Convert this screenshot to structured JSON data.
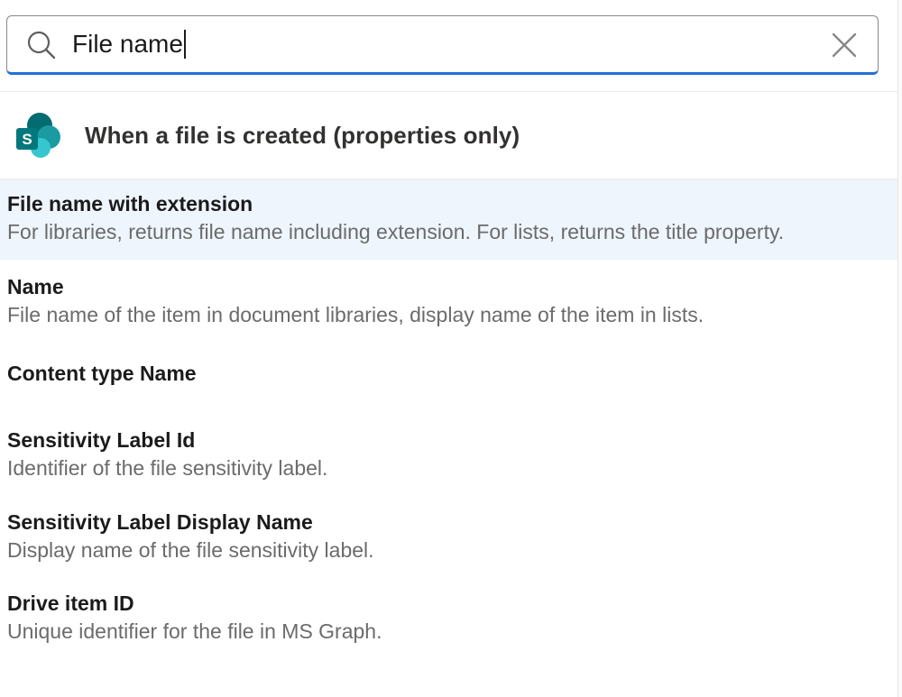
{
  "search": {
    "value": "File name",
    "icon": "search-icon",
    "clear_icon": "close-icon"
  },
  "trigger": {
    "icon": "sharepoint-icon",
    "title": "When a file is created (properties only)"
  },
  "colors": {
    "accent": "#1f6fd8",
    "selected_bg": "#eef5fc",
    "sharepoint_teal": "#038387"
  },
  "items": [
    {
      "title": "File name with extension",
      "description": "For libraries, returns file name including extension. For lists, returns the title property.",
      "selected": true
    },
    {
      "title": "Name",
      "description": "File name of the item in document libraries, display name of the item in lists.",
      "selected": false
    },
    {
      "title": "Content type Name",
      "description": "",
      "selected": false
    },
    {
      "title": "Sensitivity Label Id",
      "description": "Identifier of the file sensitivity label.",
      "selected": false
    },
    {
      "title": "Sensitivity Label Display Name",
      "description": "Display name of the file sensitivity label.",
      "selected": false
    },
    {
      "title": "Drive item ID",
      "description": "Unique identifier for the file in MS Graph.",
      "selected": false
    }
  ]
}
